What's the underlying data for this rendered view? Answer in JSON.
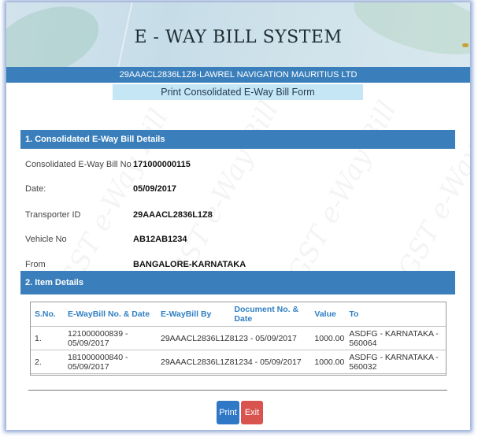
{
  "app": {
    "title": "E - WAY BILL SYSTEM",
    "company": "29AAACL2836L1Z8-LAWREL NAVIGATION MAURITIUS LTD",
    "form_title": "Print Consolidated E-Way Bill Form"
  },
  "section1": {
    "heading": "1. Consolidated E-Way Bill Details",
    "fields": [
      {
        "label": "Consolidated E-Way Bill No",
        "value": "171000000115"
      },
      {
        "label": "Date:",
        "value": "05/09/2017"
      },
      {
        "label": "Transporter ID",
        "value": "29AAACL2836L1Z8"
      },
      {
        "label": "Vehicle No",
        "value": "AB12AB1234"
      },
      {
        "label": "From",
        "value": "BANGALORE-KARNATAKA"
      }
    ]
  },
  "section2": {
    "heading": "2. Item Details",
    "columns": [
      "S.No.",
      "E-WayBill No. & Date",
      "E-WayBill By",
      "Document No. & Date",
      "Value",
      "To"
    ],
    "rows": [
      [
        "1.",
        "121000000839 - 05/09/2017",
        "29AAACL2836L1Z8",
        "123 - 05/09/2017",
        "1000.00",
        "ASDFG - KARNATAKA - 560064"
      ],
      [
        "2.",
        "181000000840 - 05/09/2017",
        "29AAACL2836L1Z8",
        "1234 - 05/09/2017",
        "1000.00",
        "ASDFG - KARNATAKA - 560032"
      ]
    ]
  },
  "actions": {
    "print_label": "Print",
    "exit_label": "Exit"
  },
  "watermark": {
    "text": "GST e-Way Bill"
  },
  "colors": {
    "primary_blue": "#3a7fbb",
    "form_title_bg": "#c5e6f5",
    "header_text_blue": "#2f7fc3",
    "print_button": "#2f78c5",
    "exit_button": "#d9534f"
  }
}
